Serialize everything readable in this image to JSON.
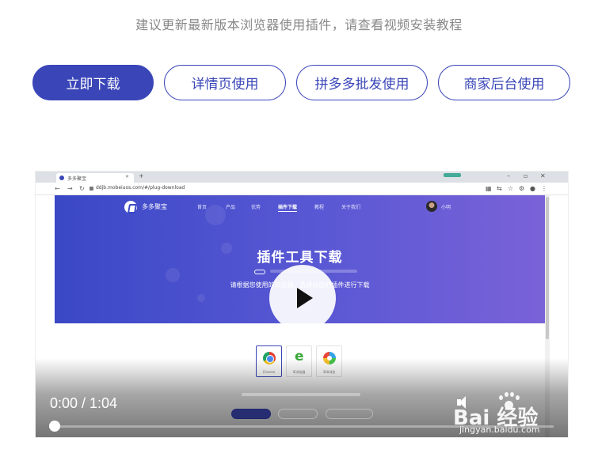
{
  "hint": "建议更新最新版本浏览器使用插件，请查看视频安装教程",
  "buttons": [
    {
      "label": "立即下载"
    },
    {
      "label": "详情页使用"
    },
    {
      "label": "拼多多批发使用"
    },
    {
      "label": "商家后台使用"
    }
  ],
  "video": {
    "current_time": "0:00",
    "duration": "1:04",
    "time_display": "0:00 / 1:04",
    "progress_fraction": 0.01,
    "browser": {
      "tab_title": "多多聚宝",
      "url": "ddjb.mobeiuos.com/#/plug-download"
    },
    "site": {
      "brand": "多多聚宝",
      "nav": [
        "首页",
        "产品",
        "优势",
        "插件下载",
        "教程",
        "关于我们"
      ],
      "active_nav": "插件下载",
      "user_name": "小明",
      "title": "插件工具下载",
      "subtitle": "请根据您使用的浏览器，选择对应的插件进行下载",
      "browsers": [
        "Chrome",
        "IE浏览器",
        "360浏览"
      ]
    }
  },
  "watermark": {
    "brand": "Bai 经验",
    "url": "jingyan.baidu.com"
  }
}
